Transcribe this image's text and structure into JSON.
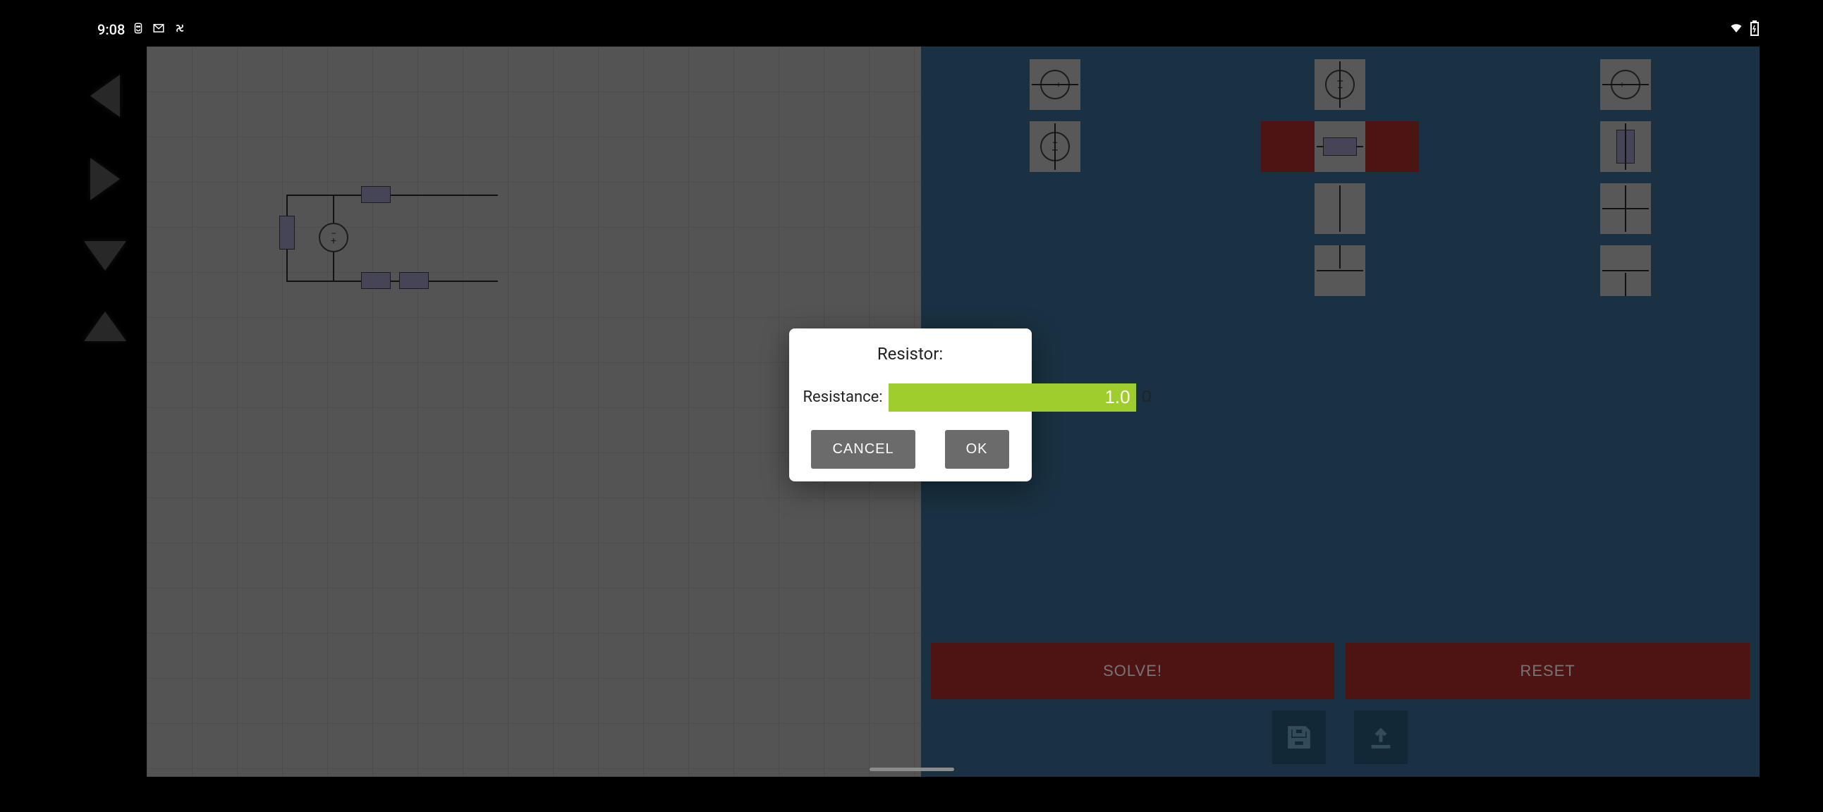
{
  "status": {
    "time": "9:08",
    "icons_left": [
      "sync-icon",
      "mail-icon",
      "fan-icon"
    ],
    "icons_right": [
      "wifi-icon",
      "battery-icon"
    ]
  },
  "nav_arrows": [
    "left",
    "right",
    "down",
    "up"
  ],
  "palette": {
    "items": [
      {
        "name": "voltage-source-h",
        "type": "circle-horiz"
      },
      {
        "name": "current-source-v",
        "type": "circle-vert"
      },
      {
        "name": "source-alt",
        "type": "circle-horiz"
      },
      {
        "name": "voltage-source-v",
        "type": "circle-vert"
      },
      {
        "name": "resistor-h",
        "type": "rect-h",
        "selected": true
      },
      {
        "name": "resistor-v",
        "type": "rect-v"
      },
      {
        "name": "empty1",
        "type": "blank"
      },
      {
        "name": "wire-v",
        "type": "wire-v"
      },
      {
        "name": "tjunction-1",
        "type": "t-junc"
      },
      {
        "name": "empty2",
        "type": "blank"
      },
      {
        "name": "wire-h",
        "type": "wire-h"
      },
      {
        "name": "tjunction-2",
        "type": "t-junc"
      },
      {
        "name": "empty3",
        "type": "blank"
      },
      {
        "name": "wire-cross",
        "type": "wire-v"
      },
      {
        "name": "tjunction-3",
        "type": "t-junc"
      }
    ]
  },
  "actions": {
    "solve_label": "SOLVE!",
    "reset_label": "RESET"
  },
  "tools": {
    "save_name": "save-icon",
    "load_name": "upload-icon"
  },
  "dialog": {
    "title": "Resistor:",
    "field_label": "Resistance:",
    "value": "1.0",
    "unit": "Ω",
    "cancel_label": "CANCEL",
    "ok_label": "OK"
  },
  "colors": {
    "accent_green": "#9ecd2d",
    "panel_blue": "#2f5a78",
    "action_red": "#8e2626"
  }
}
